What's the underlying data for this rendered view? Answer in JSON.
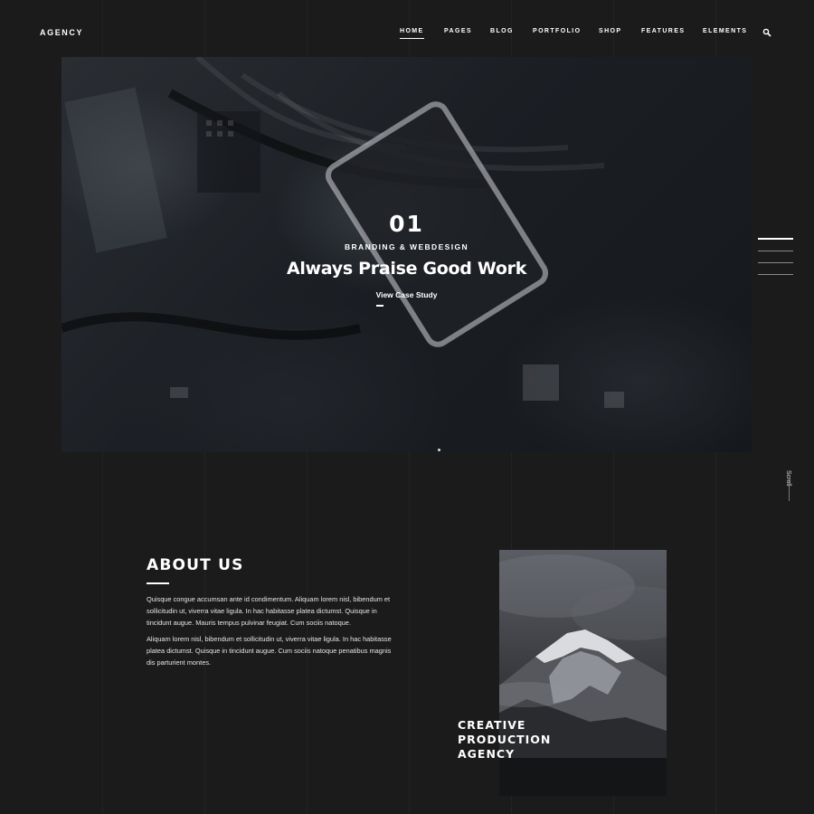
{
  "header": {
    "logo": "AGENCY",
    "nav": [
      {
        "label": "HOME",
        "active": true
      },
      {
        "label": "PAGES",
        "active": false
      },
      {
        "label": "BLOG",
        "active": false
      },
      {
        "label": "PORTFOLIO",
        "active": false
      },
      {
        "label": "SHOP",
        "active": false
      },
      {
        "label": "FEATURES",
        "active": false
      },
      {
        "label": "ELEMENTS",
        "active": false
      }
    ],
    "search_icon": "search-icon"
  },
  "hero": {
    "slide_number": "01",
    "category": "BRANDING & WEBDESIGN",
    "title": "Always Praise Good Work",
    "link_label": "View Case Study",
    "slides_total": 4,
    "active_slide": 1
  },
  "scroll_label": "Scroll",
  "about": {
    "title": "ABOUT US",
    "paragraphs": [
      "Quisque congue accumsan ante id condimentum. Aliquam lorem nisl, bibendum et sollicitudin ut, viverra vitae ligula. In hac habitasse platea dictumst. Quisque in tincidunt augue. Mauris tempus pulvinar feugiat. Cum sociis natoque.",
      "Aliquam lorem nisl, bibendum et sollicitudin ut, viverra vitae ligula. In hac habitasse platea dictumst. Quisque in tincidunt augue. Cum sociis natoque penatibus magnis dis parturient montes."
    ],
    "image_caption_lines": [
      "CREATIVE",
      "PRODUCTION",
      "AGENCY"
    ]
  },
  "colors": {
    "background": "#1b1b1c",
    "text": "#ffffff",
    "accent_line": "#ffffff"
  }
}
